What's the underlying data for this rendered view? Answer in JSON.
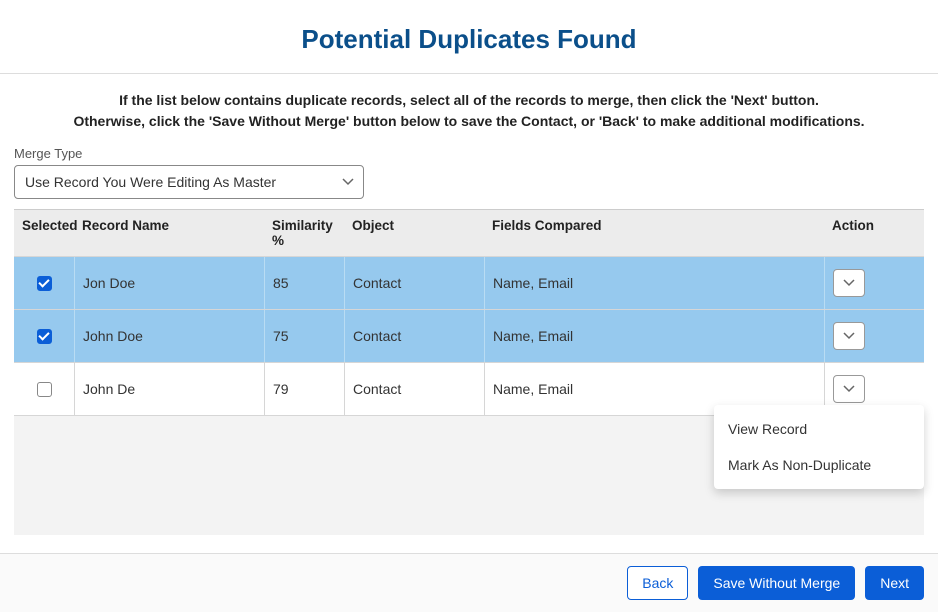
{
  "title": "Potential Duplicates Found",
  "instructions_line1": "If the list below contains duplicate records, select all of the records to merge, then click the 'Next' button.",
  "instructions_line2": "Otherwise, click the 'Save Without Merge' button below to save the Contact, or 'Back' to make additional modifications.",
  "merge_type": {
    "label": "Merge Type",
    "value": "Use Record You Were Editing As Master"
  },
  "grid": {
    "headers": {
      "selected": "Selected",
      "record_name": "Record Name",
      "similarity": "Similarity %",
      "object": "Object",
      "fields_compared": "Fields Compared",
      "action": "Action"
    },
    "rows": [
      {
        "selected": true,
        "record_name": "Jon Doe",
        "similarity": "85",
        "object": "Contact",
        "fields_compared": "Name, Email",
        "menu_open": false
      },
      {
        "selected": true,
        "record_name": "John Doe",
        "similarity": "75",
        "object": "Contact",
        "fields_compared": "Name, Email",
        "menu_open": false
      },
      {
        "selected": false,
        "record_name": "John De",
        "similarity": "79",
        "object": "Contact",
        "fields_compared": "Name, Email",
        "menu_open": true
      }
    ]
  },
  "action_menu": {
    "view_record": "View Record",
    "mark_non_dup": "Mark As Non-Duplicate"
  },
  "footer": {
    "back": "Back",
    "save_without_merge": "Save Without Merge",
    "next": "Next"
  }
}
